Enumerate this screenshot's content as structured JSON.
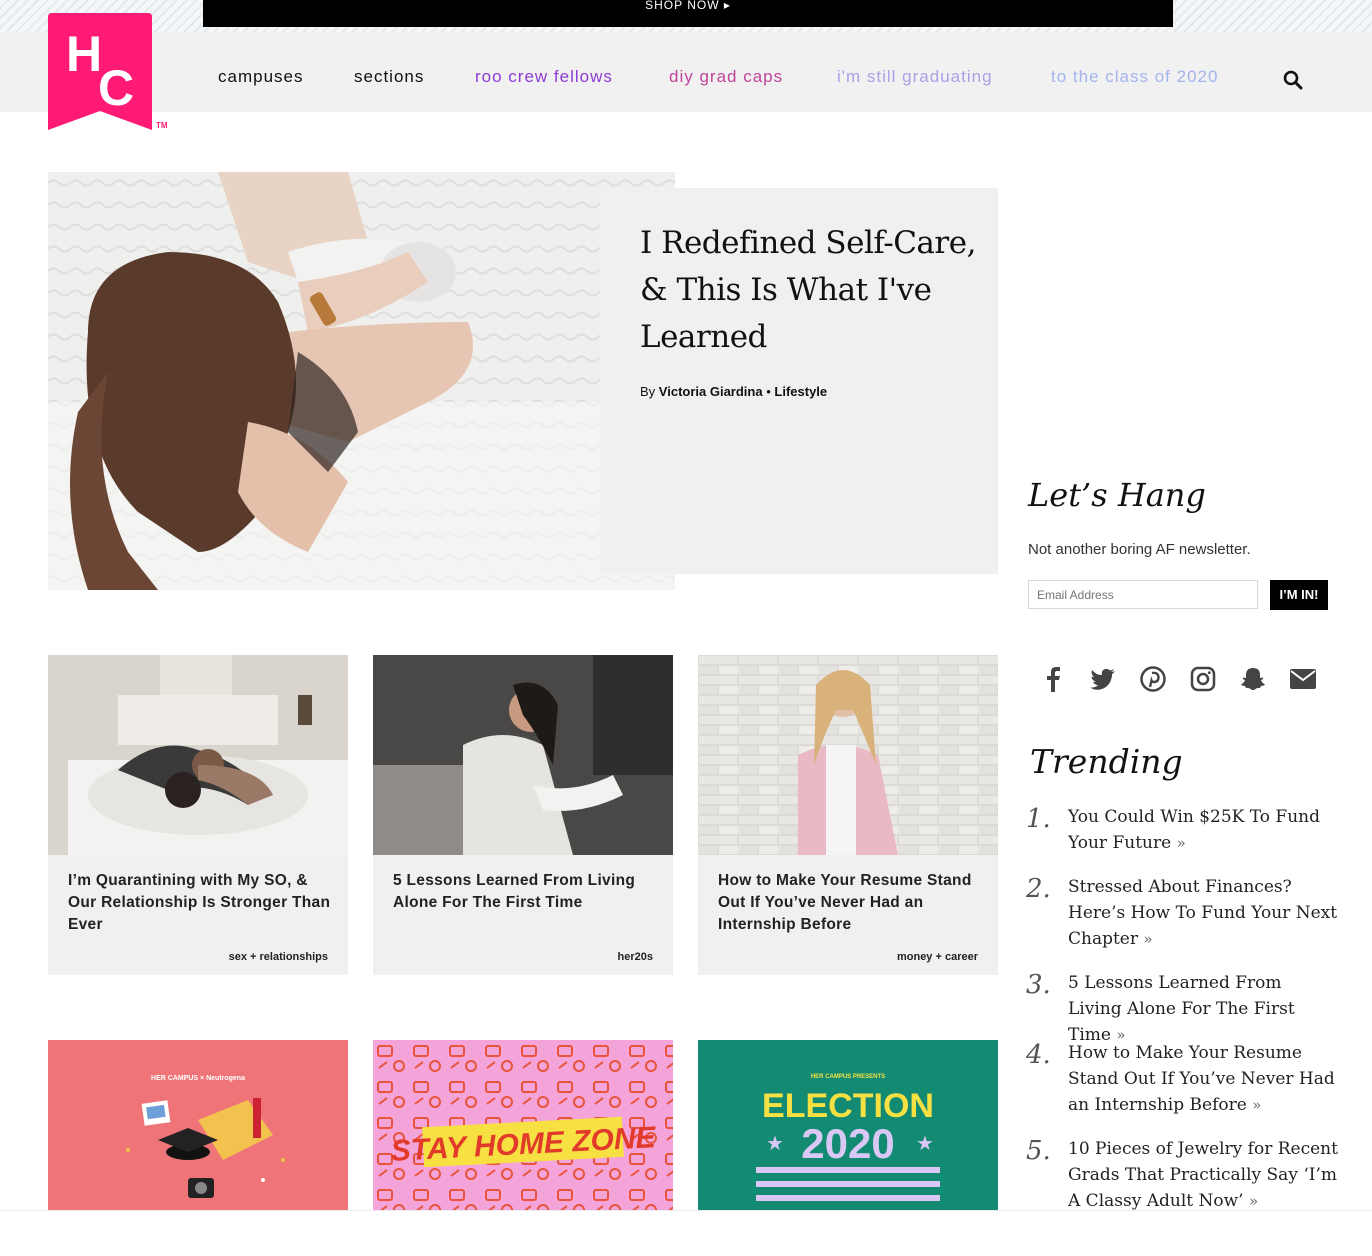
{
  "banner": {
    "text": "SHOP NOW ▸"
  },
  "nav": {
    "items": [
      {
        "label": "campuses",
        "color": "#111111"
      },
      {
        "label": "sections",
        "color": "#111111"
      },
      {
        "label": "roo crew fellows",
        "color": "#8e3bd6"
      },
      {
        "label": "diy grad caps",
        "color": "#c0449a"
      },
      {
        "label": "i'm still graduating",
        "color": "#a9a0e6"
      },
      {
        "label": "to the class of 2020",
        "color": "#a3b4ee"
      }
    ]
  },
  "colors": {
    "brand": "#ff1a75"
  },
  "hero": {
    "title": "I Redefined Self-Care, & This Is What I've Learned",
    "by": "By",
    "author": "Victoria Giardina",
    "separator": "•",
    "section": "Lifestyle"
  },
  "cards": [
    {
      "title": "I’m Quarantining with My SO, & Our Relationship Is Stronger Than Ever",
      "tag": "sex + relationships"
    },
    {
      "title": "5 Lessons Learned From Living Alone For The First Time",
      "tag": "her20s"
    },
    {
      "title": "How to Make Your Resume Stand Out If You’ve Never Had an Internship Before",
      "tag": "money + career"
    }
  ],
  "tiles": {
    "tile1_brand": "HER CAMPUS × Neutrogena",
    "tile2_text": "STAY HOME ZONE",
    "tile3_kicker": "HER CAMPUS PRESENTS",
    "tile3_line1": "ELECTION",
    "tile3_line2": "2020"
  },
  "newsletter": {
    "title": "Let’s Hang",
    "subtitle": "Not another boring AF newsletter.",
    "placeholder": "Email Address",
    "button": "I’M IN!"
  },
  "social_icons": [
    "facebook-icon",
    "twitter-icon",
    "pinterest-icon",
    "instagram-icon",
    "snapchat-icon",
    "email-icon"
  ],
  "trending": {
    "title": "Trending",
    "items": [
      {
        "num": "1.",
        "text": "You Could Win $25K To Fund Your Future"
      },
      {
        "num": "2.",
        "text": "Stressed About Finances? Here’s How To Fund Your Next Chapter"
      },
      {
        "num": "3.",
        "text": "5 Lessons Learned From Living Alone For The First Time"
      },
      {
        "num": "4.",
        "text": "How to Make Your Resume Stand Out If You’ve Never Had an Internship Before"
      },
      {
        "num": "5.",
        "text": "10 Pieces of Jewelry for Recent Grads That Practically Say ‘I’m A Classy Adult Now’"
      }
    ],
    "arrow": "»"
  },
  "logo": {
    "tm": "TM"
  }
}
